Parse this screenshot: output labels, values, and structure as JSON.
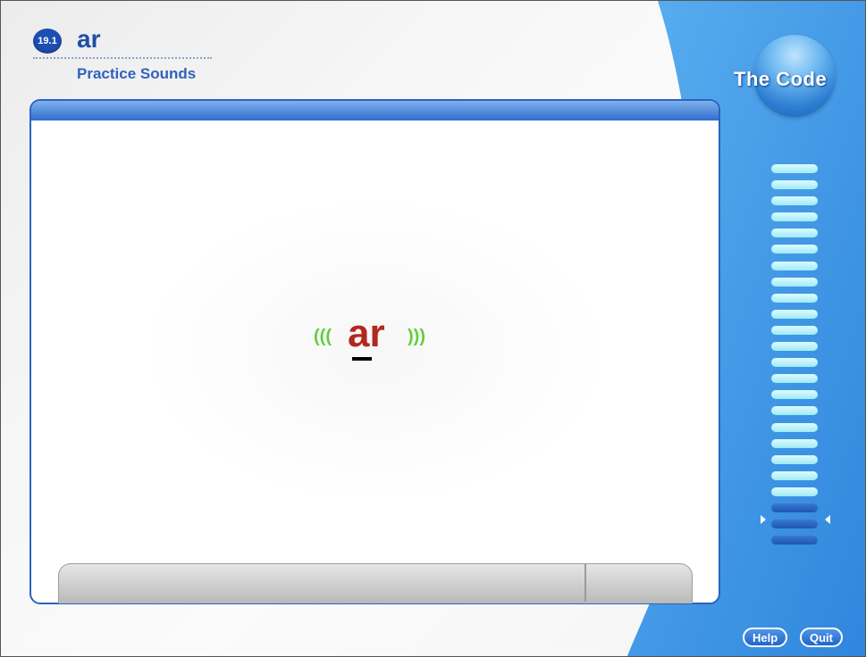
{
  "header": {
    "lesson_number": "19.1",
    "lesson_sound": "ar",
    "subtitle": "Practice Sounds"
  },
  "brand": {
    "title": "The Code"
  },
  "exercise": {
    "target_text": "ar",
    "speaker_left_glyph": "(((",
    "speaker_right_glyph": ")))"
  },
  "progress": {
    "total_rungs": 24,
    "completed_rungs": 21,
    "current_rung": 22
  },
  "footer": {
    "help_label": "Help",
    "quit_label": "Quit"
  },
  "colors": {
    "accent": "#2a63c1",
    "target_text": "#b3271f",
    "speaker": "#5fd03a",
    "rung_done": "#9eeaf7",
    "rung_pending": "#1b57b4"
  }
}
